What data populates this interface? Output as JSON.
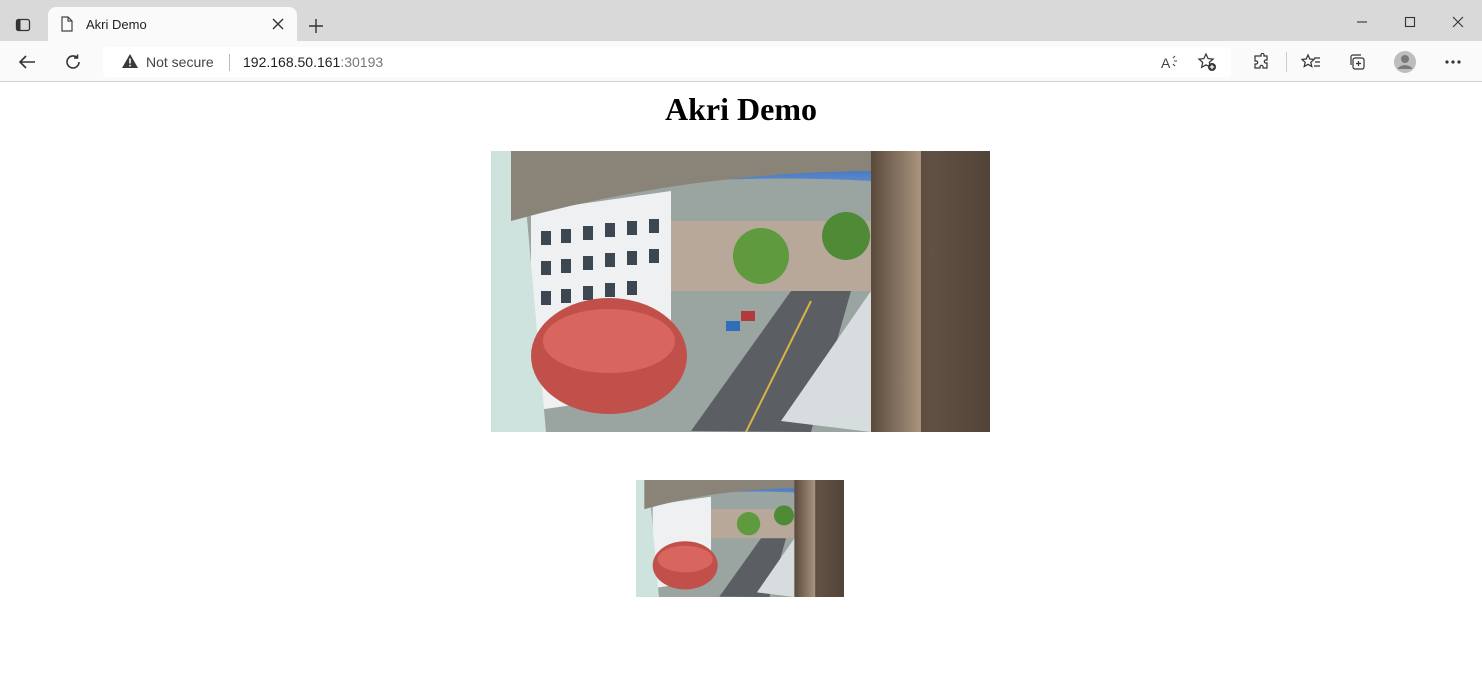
{
  "browser": {
    "tab_title": "Akri Demo",
    "address": {
      "security_label": "Not secure",
      "host": "192.168.50.161",
      "port": ":30193"
    }
  },
  "page": {
    "heading": "Akri Demo"
  }
}
